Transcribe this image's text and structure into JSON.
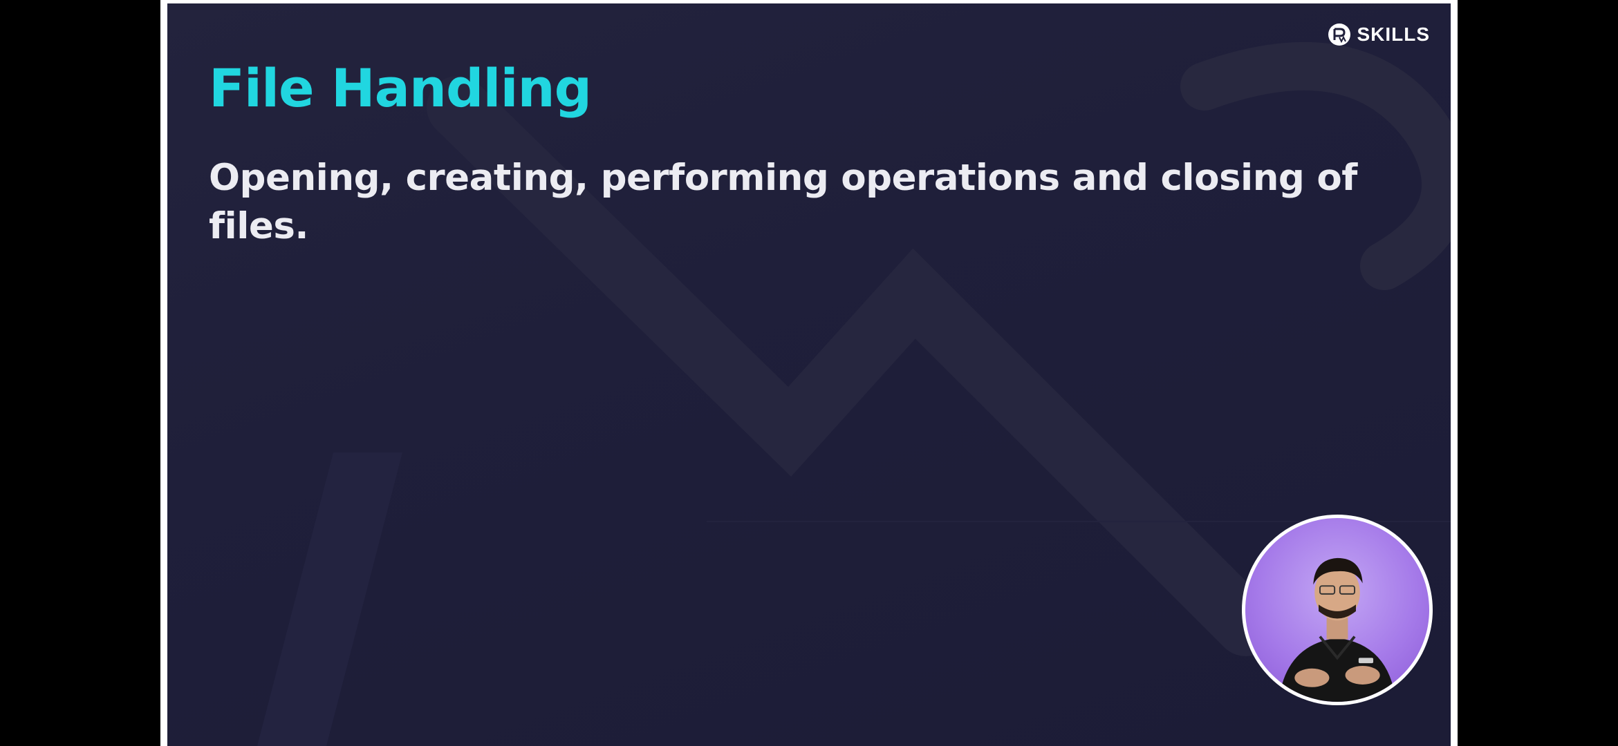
{
  "slide": {
    "title": "File Handling",
    "body": "Opening, creating, performing operations and closing of files."
  },
  "brand": {
    "label": "SKILLS",
    "icon": "pw-logo-icon"
  },
  "presenter": {
    "icon": "presenter-video-thumbnail"
  },
  "colors": {
    "background": "#1f1f3a",
    "title": "#21d6e0",
    "body_text": "#ececf2",
    "presenter_bg": "#a57ae9"
  }
}
